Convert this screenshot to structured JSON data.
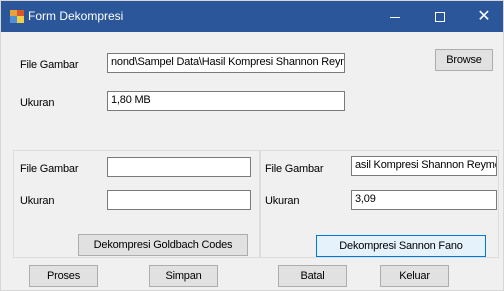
{
  "window": {
    "title": "Form Dekompresi",
    "minimize_label": "—",
    "close_label": "✕"
  },
  "top": {
    "file_label": "File Gambar",
    "file_value": "\\Sampel Data\\Hasil Kompresi Shannon Reymond",
    "file_value_prefix": "nond",
    "size_label": "Ukuran",
    "size_value": "1,80 MB",
    "browse_label": "Browse"
  },
  "left_panel": {
    "file_label": "File Gambar",
    "file_value": "",
    "size_label": "Ukuran",
    "size_value": "",
    "decompress_button": "Dekompresi Goldbach Codes"
  },
  "right_panel": {
    "file_label": "File Gambar",
    "file_value": "asil Kompresi Shannon Reymond",
    "size_label": "Ukuran",
    "size_value": "3,09",
    "decompress_button": "Dekompresi Sannon Fano"
  },
  "bottom": {
    "proses_label": "Proses",
    "simpan_label": "Simpan",
    "batal_label": "Batal",
    "keluar_label": "Keluar"
  }
}
